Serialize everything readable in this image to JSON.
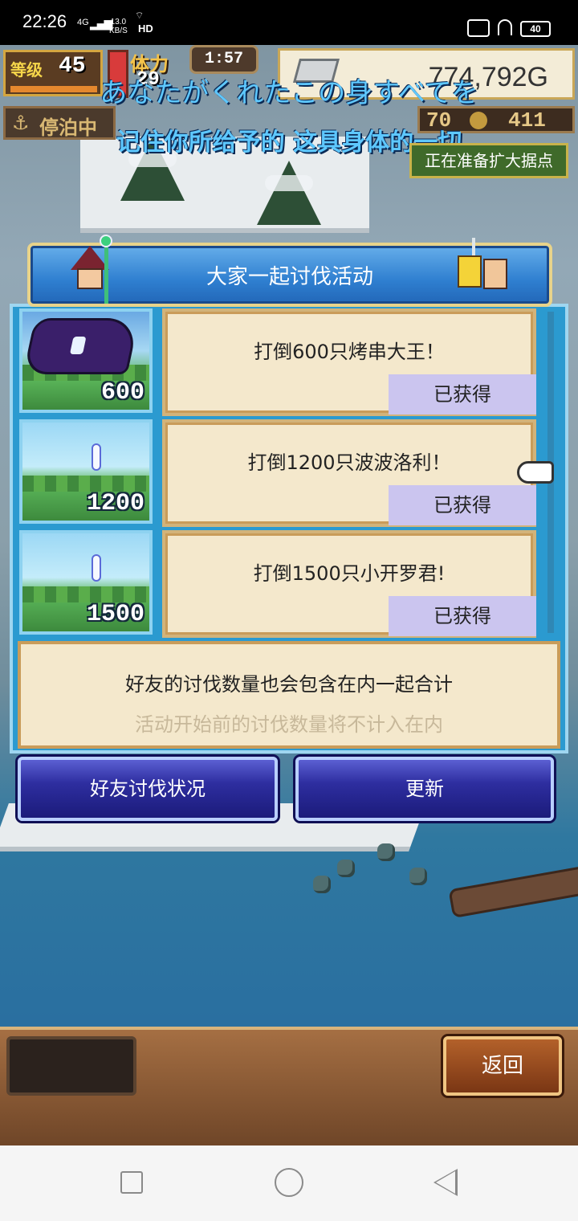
{
  "status_bar": {
    "time": "22:26",
    "network": "4G",
    "speed": "13.0",
    "speed_unit": "KB/S",
    "hd": "HD",
    "battery": "40"
  },
  "hud": {
    "level_label": "等级",
    "level": "45",
    "stamina_label": "体力",
    "stamina": "29",
    "timer": "1:57",
    "money": "774,792G",
    "dock_label": "停泊中",
    "res_a": "70",
    "res_b": "411"
  },
  "subtitle": {
    "jp": "あなたがくれたこの身すべてを",
    "cn": "记住你所给予的 这具身体的一切"
  },
  "status_tag": "正在准备扩大据点",
  "dialog": {
    "title": "大家一起讨伐活动",
    "rows": [
      {
        "count": "600",
        "text": "打倒600只烤串大王！",
        "status": "已获得"
      },
      {
        "count": "1200",
        "text": "打倒1200只波波洛利！",
        "status": "已获得"
      },
      {
        "count": "1500",
        "text": "打倒1500只小开罗君!",
        "status": "已获得"
      }
    ],
    "info_line1": "好友的讨伐数量也会包含在内一起合计",
    "info_line2": "活动开始前的讨伐数量将不计入在内",
    "friend_button": "好友讨伐状况",
    "refresh_button": "更新"
  },
  "bottom": {
    "back_button": "返回"
  },
  "icons": {
    "signal": "signal-icon",
    "wifi": "wifi-icon",
    "gamepad": "gamepad-icon",
    "headphones": "headphones-icon",
    "anchor": "anchor-icon",
    "pointer": "hand-pointer-icon"
  }
}
